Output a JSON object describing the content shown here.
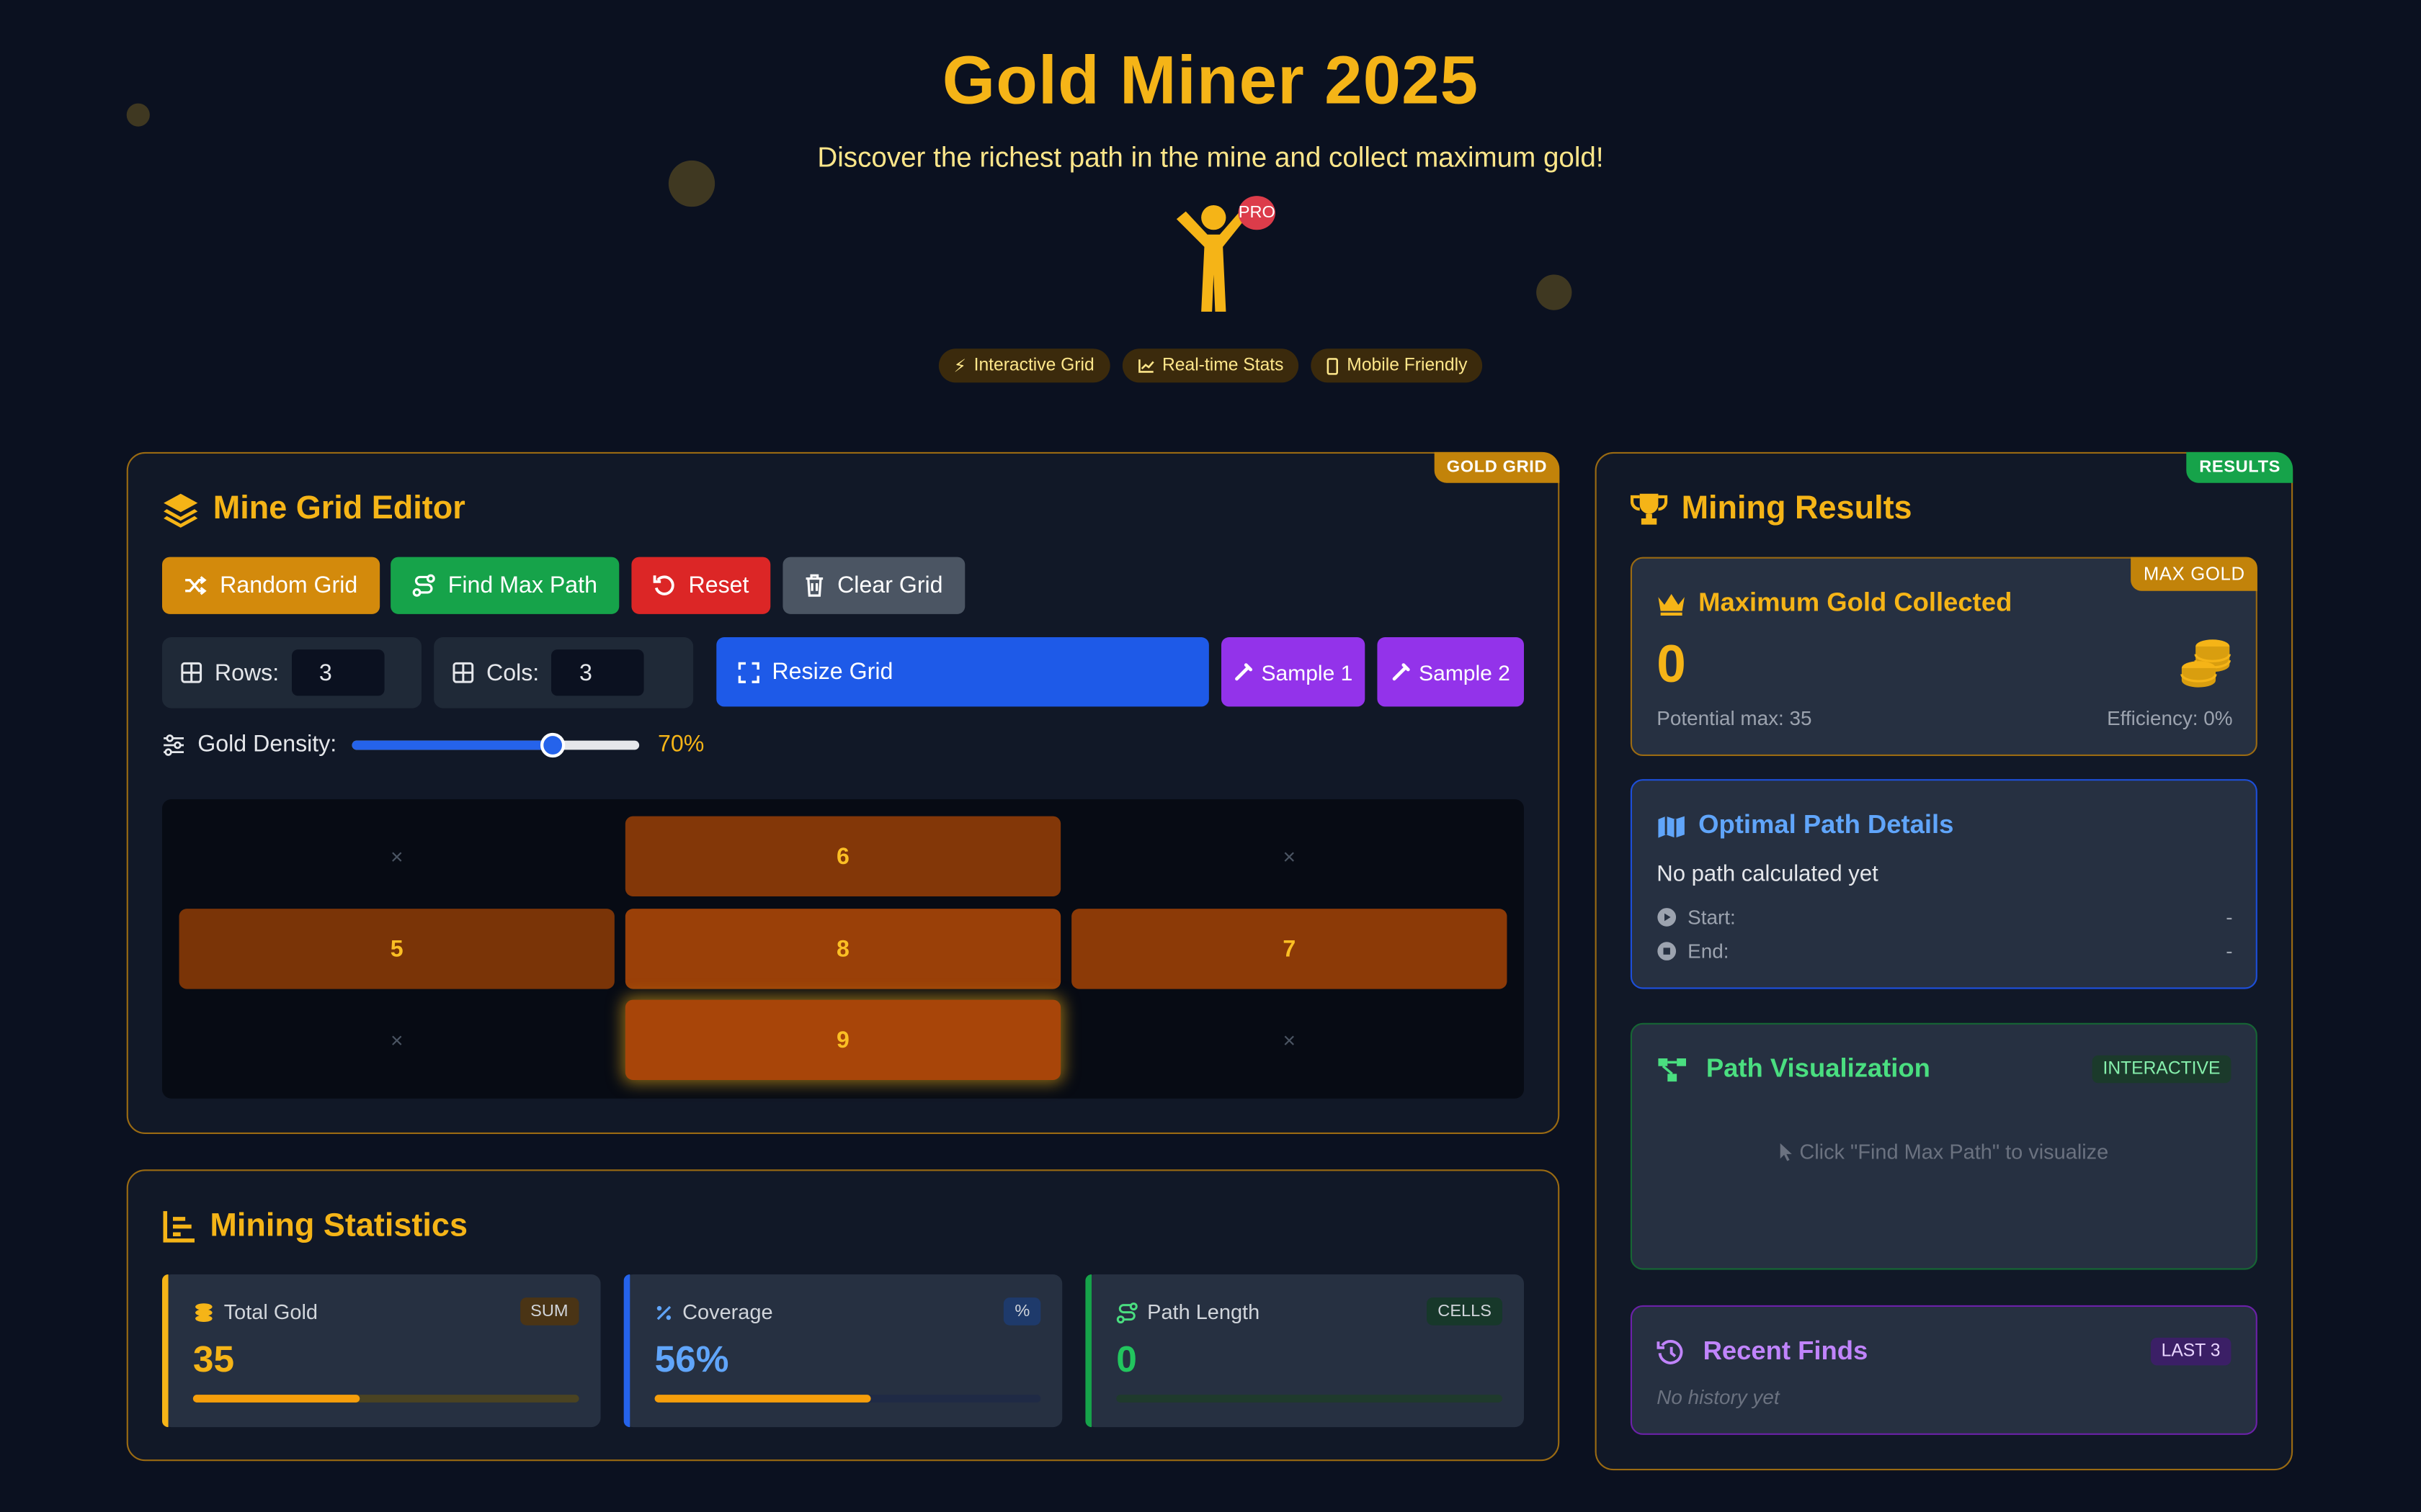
{
  "header": {
    "title": "Gold Miner 2025",
    "subtitle": "Discover the richest path in the mine and collect maximum gold!",
    "badge": "PRO",
    "chips": [
      "Interactive Grid",
      "Real-time Stats",
      "Mobile Friendly"
    ]
  },
  "editor": {
    "ribbon": "GOLD GRID",
    "title": "Mine Grid Editor",
    "buttons": {
      "random": "Random Grid",
      "find": "Find Max Path",
      "reset": "Reset",
      "clear": "Clear Grid",
      "resize": "Resize Grid",
      "sample1": "Sample 1",
      "sample2": "Sample 2"
    },
    "rows_label": "Rows:",
    "rows_value": "3",
    "cols_label": "Cols:",
    "cols_value": "3",
    "density_label": "Gold Density:",
    "density_value": 0.7,
    "density_text": "70%",
    "empty_symbol": "×",
    "grid": [
      [
        0,
        6,
        0
      ],
      [
        5,
        8,
        7
      ],
      [
        0,
        9,
        0
      ]
    ]
  },
  "statistics": {
    "title": "Mining Statistics",
    "cards": [
      {
        "label": "Total Gold",
        "tag": "SUM",
        "value": "35",
        "progress": 0.43
      },
      {
        "label": "Coverage",
        "tag": "%",
        "value": "56%",
        "progress": 0.56
      },
      {
        "label": "Path Length",
        "tag": "CELLS",
        "value": "0",
        "progress": 0
      }
    ]
  },
  "results": {
    "ribbon": "RESULTS",
    "title": "Mining Results",
    "max_gold": {
      "tag": "MAX GOLD",
      "title": "Maximum Gold Collected",
      "value": "0",
      "potential": "Potential max: 35",
      "efficiency": "Efficiency: 0%"
    },
    "path_details": {
      "title": "Optimal Path Details",
      "status": "No path calculated yet",
      "start_label": "Start:",
      "start_value": "-",
      "end_label": "End:",
      "end_value": "-"
    },
    "visualization": {
      "title": "Path Visualization",
      "tag": "INTERACTIVE",
      "hint": "Click \"Find Max Path\" to visualize"
    },
    "recent": {
      "title": "Recent Finds",
      "tag": "LAST 3",
      "empty": "No history yet"
    }
  },
  "colors": {
    "gold": "#f5b417",
    "background": "#0b1120",
    "panel": "#111827",
    "blue": "#1e5ae8",
    "green": "#16a34a",
    "red": "#dc2626",
    "purple": "#9333ea"
  }
}
